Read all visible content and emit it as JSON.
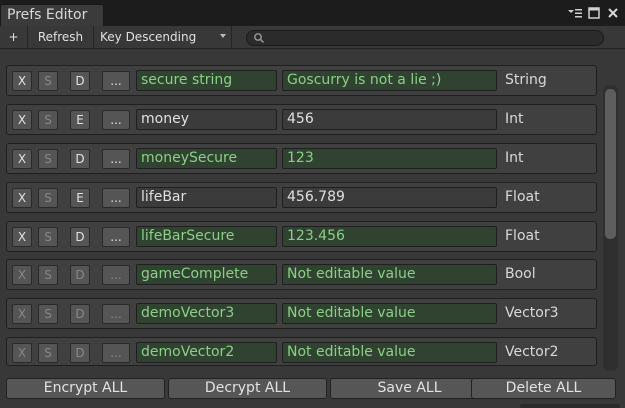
{
  "window": {
    "tab_title": "Prefs Editor"
  },
  "toolbar": {
    "add_label": "+",
    "refresh_label": "Refresh",
    "sort_selected": "Key Descending",
    "search_value": ""
  },
  "colors": {
    "secure_field": "#304330",
    "secure_text": "#8ccf88",
    "plain_field": "#3b3b3b"
  },
  "rows": [
    {
      "x": "X",
      "s": "S",
      "mode": "D",
      "more": "...",
      "key": "secure string",
      "value": "Goscurry is not a lie ;)",
      "type": "String",
      "secure": true
    },
    {
      "x": "X",
      "s": "S",
      "mode": "E",
      "more": "...",
      "key": "money",
      "value": "456",
      "type": "Int",
      "secure": false
    },
    {
      "x": "X",
      "s": "S",
      "mode": "D",
      "more": "...",
      "key": "moneySecure",
      "value": "123",
      "type": "Int",
      "secure": true
    },
    {
      "x": "X",
      "s": "S",
      "mode": "E",
      "more": "...",
      "key": "lifeBar",
      "value": "456.789",
      "type": "Float",
      "secure": false
    },
    {
      "x": "X",
      "s": "S",
      "mode": "D",
      "more": "...",
      "key": "lifeBarSecure",
      "value": "123.456",
      "type": "Float",
      "secure": true
    },
    {
      "x": "X",
      "s": "S",
      "mode": "D",
      "more": "...",
      "key": "gameComplete",
      "value": "Not editable value",
      "type": "Bool",
      "secure": true
    },
    {
      "x": "X",
      "s": "S",
      "mode": "D",
      "more": "...",
      "key": "demoVector3",
      "value": "Not editable value",
      "type": "Vector3",
      "secure": true
    },
    {
      "x": "X",
      "s": "S",
      "mode": "D",
      "more": "...",
      "key": "demoVector2",
      "value": "Not editable value",
      "type": "Vector2",
      "secure": true
    }
  ],
  "actions": {
    "encrypt_all": "Encrypt ALL",
    "decrypt_all": "Decrypt ALL",
    "save_all": "Save ALL",
    "delete_all": "Delete ALL"
  }
}
